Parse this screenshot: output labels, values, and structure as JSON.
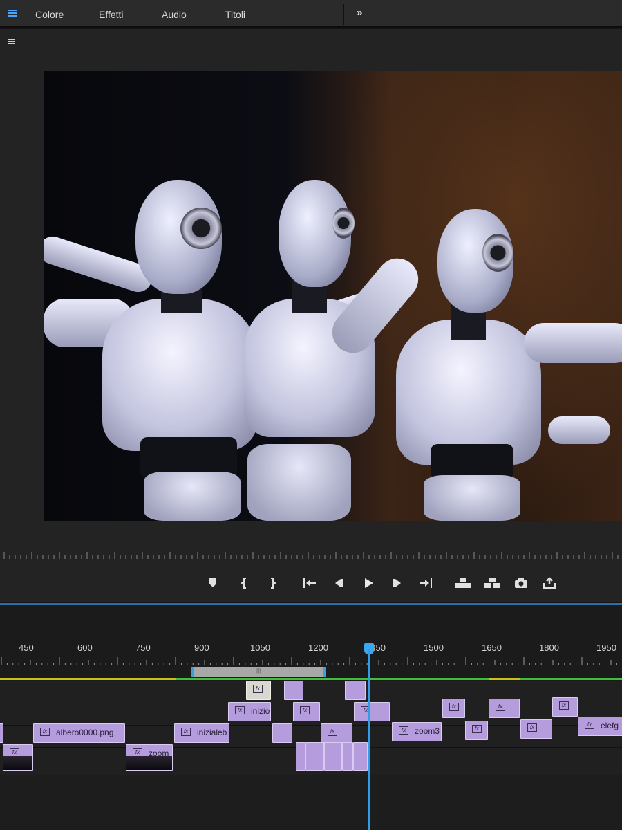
{
  "menu_tabs": [
    "Colore",
    "Effetti",
    "Audio",
    "Titoli"
  ],
  "more_label": "»",
  "ruler": {
    "labels": [
      "450",
      "600",
      "750",
      "900",
      "1050",
      "1200",
      "1350",
      "1500",
      "1650",
      "1800",
      "1950"
    ]
  },
  "transport": {
    "marker": "add-marker-icon",
    "mark_in": "mark-in-icon",
    "mark_out": "mark-out-icon",
    "go_in": "go-to-in-icon",
    "step_back": "step-back-icon",
    "play": "play-icon",
    "step_fwd": "step-forward-icon",
    "go_out": "go-to-out-icon",
    "lift": "lift-icon",
    "extract": "extract-icon",
    "export_frame": "camera-icon",
    "export": "export-icon"
  },
  "clips": {
    "fx_label": "fx",
    "track1": [
      {
        "name": ""
      },
      {
        "name": ""
      },
      {
        "name": ""
      }
    ],
    "track2": [
      {
        "name": "inizio"
      },
      {
        "name": ""
      },
      {
        "name": ""
      },
      {
        "name": ""
      },
      {
        "name": ""
      },
      {
        "name": ""
      }
    ],
    "track3": [
      {
        "name": "albero0000.png"
      },
      {
        "name": "inizialeb"
      },
      {
        "name": ""
      },
      {
        "name": "zoom3"
      },
      {
        "name": ""
      },
      {
        "name": ""
      },
      {
        "name": "elefg"
      }
    ],
    "track4": [
      {
        "name": ""
      },
      {
        "name": "zoom"
      }
    ]
  },
  "colors": {
    "accent": "#2f9ee6",
    "clip": "#b59cdc",
    "render_yellow": "#c8c21a",
    "render_green": "#3fbf3a"
  }
}
